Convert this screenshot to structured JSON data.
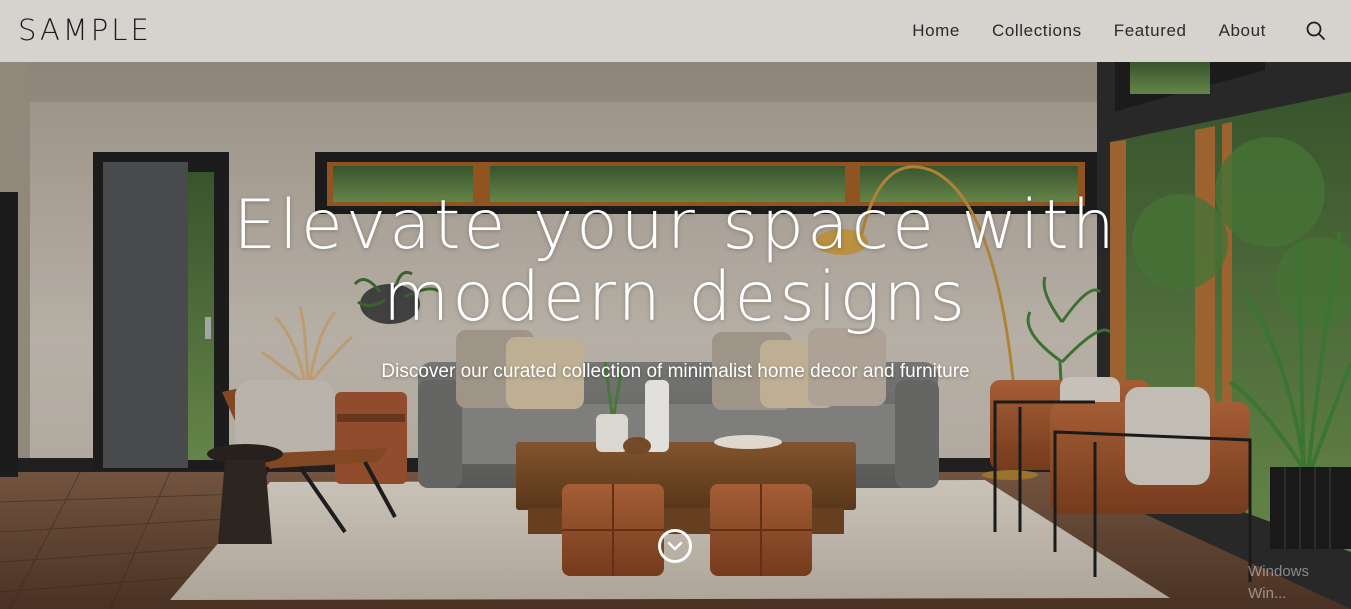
{
  "header": {
    "logo": "SAMPLE",
    "nav": [
      {
        "label": "Home"
      },
      {
        "label": "Collections"
      },
      {
        "label": "Featured"
      },
      {
        "label": "About"
      }
    ],
    "search_icon": "search-icon"
  },
  "hero": {
    "title_line1": "Elevate your space with",
    "title_line2": "modern designs",
    "subtitle": "Discover our curated collection of minimalist home decor and furniture",
    "scroll_icon": "chevron-down-icon"
  },
  "watermark": {
    "line1": "Windows",
    "line2": "Win..."
  },
  "colors": {
    "header_bg": "#d6d3cf",
    "text_dark": "#1c1c1c",
    "hero_text": "#ffffff"
  }
}
